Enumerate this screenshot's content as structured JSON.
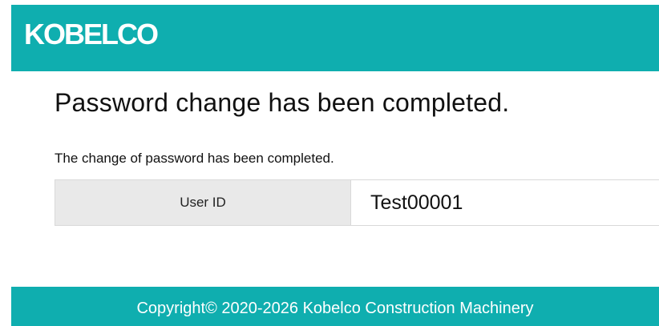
{
  "header": {
    "logo_text": "KOBELCO",
    "background_color": "#0faeaf"
  },
  "main": {
    "title": "Password change has been completed.",
    "message": "The change of password has been completed.",
    "user_info": {
      "label": "User ID",
      "value": "Test00001"
    }
  },
  "footer": {
    "copyright": "Copyright© 2020-2026 Kobelco Construction Machinery",
    "background_color": "#0faeaf"
  }
}
